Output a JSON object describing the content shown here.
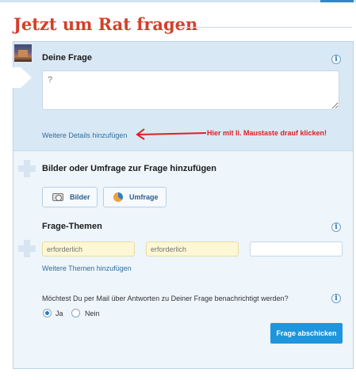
{
  "header": {
    "title": "Jetzt um Rat fragen"
  },
  "question": {
    "label": "Deine Frage",
    "placeholder": "?",
    "details_link": "Weitere Details hinzufügen"
  },
  "annotation": {
    "text": "Hier mit li. Maustaste drauf klicken!",
    "color": "#e02020"
  },
  "media": {
    "label": "Bilder oder Umfrage zur Frage hinzufügen",
    "images_button": "Bilder",
    "poll_button": "Umfrage"
  },
  "topics": {
    "label": "Frage-Themen",
    "fields": [
      {
        "placeholder": "erforderlich"
      },
      {
        "placeholder": "erforderlich"
      },
      {
        "placeholder": ""
      }
    ],
    "more_link": "Weitere Themen hinzufügen"
  },
  "notify": {
    "question": "Möchtest Du per Mail über Antworten zu Deiner Frage benachrichtigt werden?",
    "yes": "Ja",
    "no": "Nein",
    "selected": "Ja"
  },
  "submit_label": "Frage abschicken",
  "icons": {
    "info": "i",
    "avatar": "avatar-image",
    "camera": "camera-icon",
    "poll": "poll-icon"
  },
  "colors": {
    "title": "#d3402b",
    "link": "#2e6f9f",
    "submit": "#1f95dd",
    "panel_top": "#d9e8f5",
    "panel": "#eef5fb",
    "required_field": "#fdf7d5"
  }
}
